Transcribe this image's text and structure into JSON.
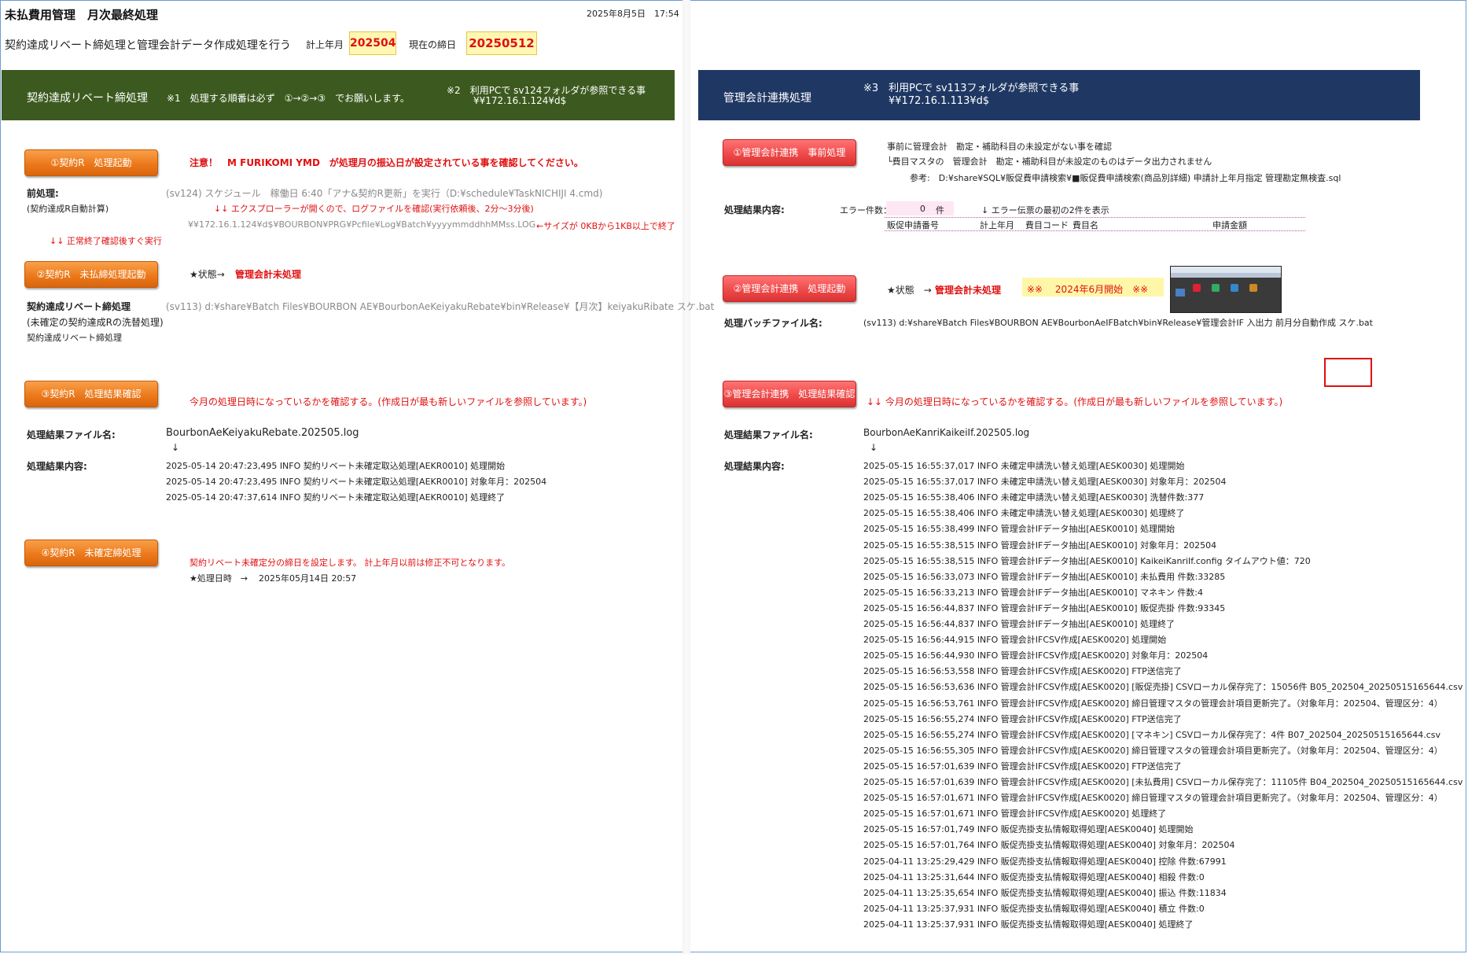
{
  "header": {
    "title": "未払費用管理　月次最終処理",
    "datetime": "2025年8月5日　17:54",
    "subtitle": "契約達成リベート締処理と管理会計データ作成処理を行う",
    "keijo_label": "計上年月",
    "keijo_value": "202504",
    "shime_label": "現在の締日",
    "shime_value": "20250512"
  },
  "left": {
    "band_title": "契約達成リベート締処理",
    "band_note1": "※1　処理する順番は必ず　①→②→③　でお願いします。",
    "band_note2_l1": "※2　利用PCで sv124フォルダが参照できる事",
    "band_note2_l2": "¥¥172.16.1.124¥d$",
    "step1": {
      "button": "①契約R　処理起動",
      "warning": "注意！　M FURIKOMI YMD　が処理月の振込日が設定されている事を確認してください。",
      "pre_label": "前処理:",
      "pre_sub": "(契約達成R自動計算)",
      "schedule": "(sv124) スケジュール　稼働日 6:40「アナ&契約R更新」を実行（D:¥schedule¥TaskNICHIJI 4.cmd)",
      "explorer_note": "↓↓ エクスプローラーが開くので、ログファイルを確認(実行依頼後、2分～3分後)",
      "log_path": "¥¥172.16.1.124¥d$¥BOURBON¥PRG¥Pcfile¥Log¥Batch¥yyyymmddhhMMss.LOG",
      "size_note": "←サイズが 0KBから1KB以上で終了",
      "after_note": "↓↓ 正常終了確認後すぐ実行"
    },
    "step2": {
      "button": "②契約R　未払締処理起動",
      "status_label": "★状態→",
      "status_value": "管理会計未処理",
      "proc_label": "契約達成リベート締処理",
      "proc_sub1": "(未確定の契約達成Rの洗替処理)",
      "proc_sub2": "契約達成リベート締処理",
      "bat_path": "(sv113) d:¥share¥Batch Files¥BOURBON AE¥BourbonAeKeiyakuRebate¥bin¥Release¥【月次】keiyakuRibate スケ.bat"
    },
    "step3": {
      "button": "③契約R　処理結果確認",
      "note": "今月の処理日時になっているかを確認する。(作成日が最も新しいファイルを参照しています。)",
      "file_label": "処理結果ファイル名:",
      "file_value": "BourbonAeKeiyakuRebate.202505.log",
      "arrow": "↓",
      "result_label": "処理結果内容:",
      "lines": [
        "2025-05-14 20:47:23,495 INFO  契約リベート未確定取込処理[AEKR0010] 処理開始",
        "2025-05-14 20:47:23,495 INFO  契約リベート未確定取込処理[AEKR0010] 対象年月：202504",
        "2025-05-14 20:47:37,614 INFO  契約リベート未確定取込処理[AEKR0010] 処理終了"
      ]
    },
    "step4": {
      "button": "④契約R　未確定締処理",
      "note": "契約リベート未確定分の締日を設定します。 計上年月以前は修正不可となります。",
      "datetime_label": "★処理日時　→",
      "datetime_value": "2025年05月14日 20:57"
    }
  },
  "right": {
    "band_title": "管理会計連携処理",
    "band_note_l1": "※3　利用PCで sv113フォルダが参照できる事",
    "band_note_l2": "¥¥172.16.1.113¥d$",
    "step1": {
      "button": "①管理会計連携　事前処理",
      "note1": "事前に管理会計　勘定・補助科目の未設定がない事を確認",
      "note2": "└費目マスタの　管理会計　勘定・補助科目が未設定のものはデータ出力されません",
      "ref": "参考:　D:¥share¥SQL¥販促費申請検索¥■販促費申請検索(商品別詳細) 申請計上年月指定 管理勘定無検査.sql",
      "result_label": "処理結果内容:",
      "error_label": "エラー件数：",
      "error_count": "0",
      "error_unit": "件",
      "error_note": "↓ エラー伝票の最初の2件を表示",
      "columns": [
        "販促申請番号",
        "計上年月",
        "費目コード",
        "費目名",
        "申請金額"
      ]
    },
    "step2": {
      "button": "②管理会計連携　処理起動",
      "status_label": "★状態　→",
      "status_value": "管理会計未処理",
      "start_note": "※※　 2024年6月開始　※※",
      "bat_label": "処理バッチファイル名:",
      "bat_path": "(sv113) d:¥share¥Batch Files¥BOURBON AE¥BourbonAeIFBatch¥bin¥Release¥管理会計IF 入出力 前月分自動作成 スケ.bat"
    },
    "step3": {
      "button": "③管理会計連携　処理結果確認",
      "note": "↓↓ 今月の処理日時になっているかを確認する。(作成日が最も新しいファイルを参照しています。)",
      "file_label": "処理結果ファイル名:",
      "file_value": "BourbonAeKanriKaikeiIf.202505.log",
      "arrow": "↓",
      "result_label": "処理結果内容:",
      "lines": [
        "2025-05-15 16:55:37,017 INFO  未確定申請洗い替え処理[AESK0030] 処理開始",
        "2025-05-15 16:55:37,017 INFO  未確定申請洗い替え処理[AESK0030] 対象年月：202504",
        "2025-05-15 16:55:38,406 INFO  未確定申請洗い替え処理[AESK0030] 洗替件数:377",
        "2025-05-15 16:55:38,406 INFO  未確定申請洗い替え処理[AESK0030] 処理終了",
        "2025-05-15 16:55:38,499 INFO  管理会計IFデータ抽出[AESK0010] 処理開始",
        "2025-05-15 16:55:38,515 INFO  管理会計IFデータ抽出[AESK0010] 対象年月：202504",
        "2025-05-15 16:55:38,515 INFO  管理会計IFデータ抽出[AESK0010] KaikeiKanriIf.config  タイムアウト値：720",
        "2025-05-15 16:56:33,073 INFO  管理会計IFデータ抽出[AESK0010] 未払費用 件数:33285",
        "2025-05-15 16:56:33,213 INFO  管理会計IFデータ抽出[AESK0010] マネキン 件数:4",
        "2025-05-15 16:56:44,837 INFO  管理会計IFデータ抽出[AESK0010] 販促売掛 件数:93345",
        "2025-05-15 16:56:44,837 INFO  管理会計IFデータ抽出[AESK0010] 処理終了",
        "2025-05-15 16:56:44,915 INFO  管理会計IFCSV作成[AESK0020] 処理開始",
        "2025-05-15 16:56:44,930 INFO  管理会計IFCSV作成[AESK0020] 対象年月：202504",
        "2025-05-15 16:56:53,558 INFO  管理会計IFCSV作成[AESK0020] FTP送信完了",
        "2025-05-15 16:56:53,636 INFO  管理会計IFCSV作成[AESK0020] [販促売掛] CSVローカル保存完了：15056件 B05_202504_20250515165644.csv",
        "2025-05-15 16:56:53,761 INFO  管理会計IFCSV作成[AESK0020]  締日管理マスタの管理会計項目更新完了。（対象年月：202504、管理区分：4）",
        "2025-05-15 16:56:55,274 INFO  管理会計IFCSV作成[AESK0020] FTP送信完了",
        "2025-05-15 16:56:55,274 INFO  管理会計IFCSV作成[AESK0020] [マネキン] CSVローカル保存完了：4件 B07_202504_20250515165644.csv",
        "2025-05-15 16:56:55,305 INFO  管理会計IFCSV作成[AESK0020]  締日管理マスタの管理会計項目更新完了。（対象年月：202504、管理区分：4）",
        "2025-05-15 16:57:01,639 INFO  管理会計IFCSV作成[AESK0020] FTP送信完了",
        "2025-05-15 16:57:01,639 INFO  管理会計IFCSV作成[AESK0020] [未払費用] CSVローカル保存完了：11105件 B04_202504_20250515165644.csv",
        "2025-05-15 16:57:01,671 INFO  管理会計IFCSV作成[AESK0020]  締日管理マスタの管理会計項目更新完了。（対象年月：202504、管理区分：4）",
        "2025-05-15 16:57:01,671 INFO  管理会計IFCSV作成[AESK0020] 処理終了",
        "2025-05-15 16:57:01,749 INFO  販促売掛支払情報取得処理[AESK0040] 処理開始",
        "2025-05-15 16:57:01,764 INFO  販促売掛支払情報取得処理[AESK0040] 対象年月：202504",
        "2025-04-11 13:25:29,429 INFO  販促売掛支払情報取得処理[AESK0040] 控除 件数:67991",
        "2025-04-11 13:25:31,644 INFO  販促売掛支払情報取得処理[AESK0040] 相殺 件数:0",
        "2025-04-11 13:25:35,654 INFO  販促売掛支払情報取得処理[AESK0040] 振込 件数:11834",
        "2025-04-11 13:25:37,931 INFO  販促売掛支払情報取得処理[AESK0040] 積立 件数:0",
        "2025-04-11 13:25:37,931 INFO  販促売掛支払情報取得処理[AESK0040] 処理終了"
      ]
    }
  },
  "colors": {
    "left_band": "#3c5a1f",
    "right_band": "#1f3863",
    "orange_button": "#ec7a1c",
    "red_button": "#ef4a4a",
    "alert_red": "#e01010",
    "highlight_yellow": "#fff7b3"
  }
}
